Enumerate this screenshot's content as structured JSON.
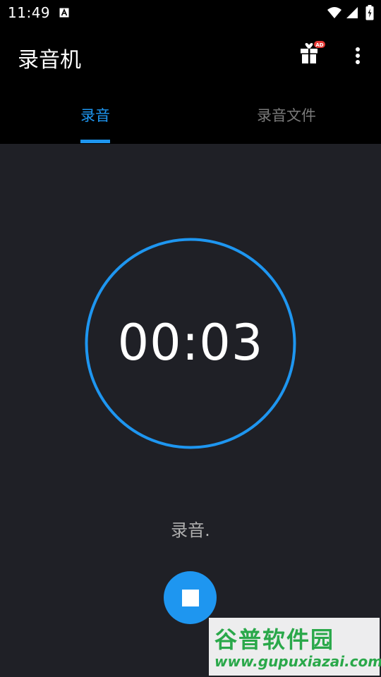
{
  "status_bar": {
    "time": "11:49"
  },
  "app_bar": {
    "title": "录音机",
    "gift_badge": "AD"
  },
  "tabs": [
    {
      "label": "录音",
      "selected": true
    },
    {
      "label": "录音文件",
      "selected": false
    }
  ],
  "recorder": {
    "elapsed": "00:03",
    "status": "录音."
  },
  "watermark": {
    "line1": "谷普软件园",
    "line2": "www.gupuxiazai.com"
  },
  "colors": {
    "accent": "#1e96f0",
    "background": "#1f2026",
    "topbar": "#000000",
    "tab_inactive": "#7a7a7a",
    "status_text": "#b0b0b0",
    "watermark": "#2aa84a"
  },
  "icons": {
    "status_a": "a-icon",
    "wifi": "wifi-icon",
    "signal": "signal-icon",
    "battery": "battery-icon",
    "gift": "gift-icon",
    "more": "more-vert-icon",
    "stop": "stop-icon"
  }
}
